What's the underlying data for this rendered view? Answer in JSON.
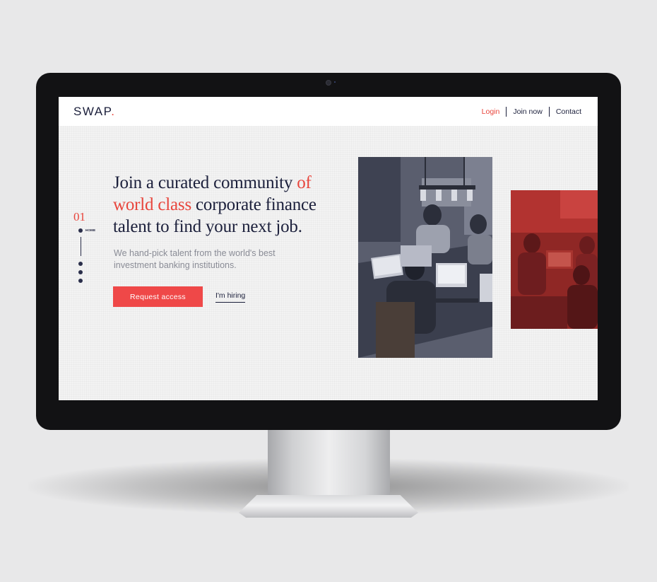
{
  "brand": {
    "name": "SWAP",
    "dot": ".",
    "accent_color": "#e8453c",
    "navy": "#1b1f3b"
  },
  "nav": {
    "login": "Login",
    "join": "Join now",
    "contact": "Contact"
  },
  "pager": {
    "number": "01",
    "label": "HOME"
  },
  "hero": {
    "headline_part1": "Join a curated community ",
    "headline_accent": "of world class",
    "headline_part2": " corporate finance talent to find your next job.",
    "subtext": "We hand-pick talent from the world's best investment banking institutions.",
    "primary_button": "Request  access",
    "secondary_link": "I'm hiring"
  },
  "images": {
    "main_photo": "team-working-on-laptops-photo",
    "side_photo": "red-tinted-team-photo"
  }
}
